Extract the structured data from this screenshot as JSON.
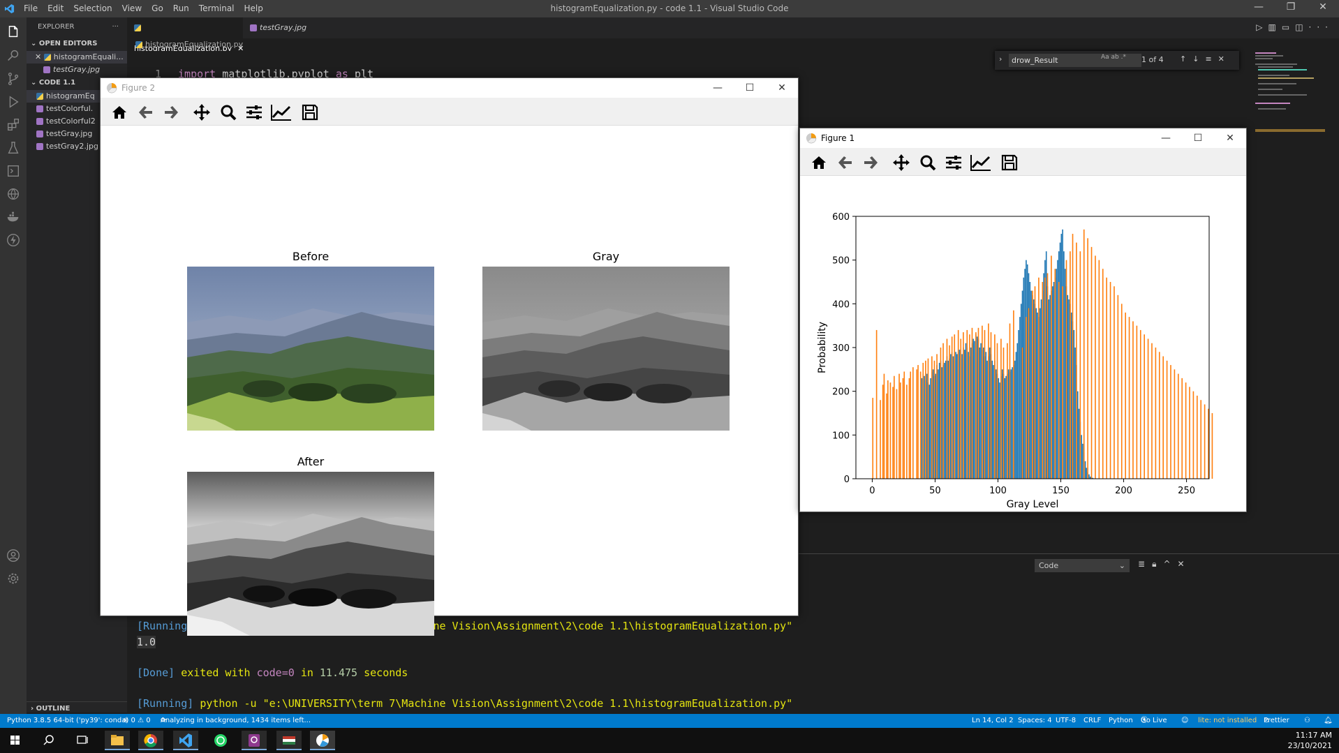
{
  "window": {
    "title": "histogramEqualization.py - code 1.1 - Visual Studio Code",
    "menu": [
      "File",
      "Edit",
      "Selection",
      "View",
      "Go",
      "Run",
      "Terminal",
      "Help"
    ]
  },
  "sidebar": {
    "header": "EXPLORER",
    "open_editors_label": "OPEN EDITORS",
    "open_editors": [
      "histogramEquali...",
      "testGray.jpg"
    ],
    "folder_label": "CODE 1.1",
    "files": [
      "histogramEq",
      "testColorful.",
      "testColorful2",
      "testGray.jpg",
      "testGray2.jpg"
    ],
    "outline_label": "OUTLINE"
  },
  "tabs": [
    {
      "label": "histogramEqualization.py",
      "active": true
    },
    {
      "label": "testGray.jpg",
      "active": false
    }
  ],
  "breadcrumb": "histogramEqualization.py",
  "editor": {
    "line_number": "1",
    "code": {
      "kw1": "import",
      "mod": "matplotlib.pyplot",
      "kw2": "as",
      "alias": "plt"
    }
  },
  "find": {
    "query": "drow_Result",
    "options": "Aa ab .*",
    "count": "1 of 4"
  },
  "panel": {
    "select_value": "Code",
    "lines": [
      {
        "tag": "[Running]",
        "text": "python -u \"e:\\UNIVERSITY\\term 7\\Machine Vision\\Assignment\\2\\code 1.1\\histogramEqualization.py\""
      },
      {
        "value": "1.0"
      },
      {
        "tag": "[Done]",
        "text1": "exited with",
        "code": "code=0",
        "text2": "in",
        "secs": "11.475",
        "text3": "seconds"
      },
      {
        "tag": "[Running]",
        "text": "python -u \"e:\\UNIVERSITY\\term 7\\Machine Vision\\Assignment\\2\\code 1.1\\histogramEqualization.py\""
      }
    ]
  },
  "statusbar": {
    "python": "Python 3.8.5 64-bit ('py39': conda)",
    "problems": "⊗ 0 ⚠ 0",
    "analysis": "Analyzing in background, 1434 items left...",
    "position": "Ln 14, Col 2",
    "spaces": "Spaces: 4",
    "encoding": "UTF-8",
    "eol": "CRLF",
    "language": "Python",
    "golive": "Go Live",
    "lite": "lite: not installed",
    "prettier": "Prettier"
  },
  "taskbar": {
    "time": "11:17 AM",
    "date": "23/10/2021"
  },
  "figure2": {
    "title": "Figure 2",
    "subplots": [
      "Before",
      "Gray",
      "After"
    ]
  },
  "figure1": {
    "title": "Figure 1"
  },
  "chart_data": {
    "type": "bar",
    "title": "",
    "xlabel": "Gray Level",
    "ylabel": "Probability",
    "xlim": [
      -13,
      268
    ],
    "ylim": [
      0,
      600
    ],
    "xticks": [
      0,
      50,
      100,
      150,
      200,
      250
    ],
    "yticks": [
      0,
      100,
      200,
      300,
      400,
      500,
      600
    ],
    "series": [
      {
        "color": "#1f77b4",
        "x_start": 0,
        "values": [
          0,
          0,
          0,
          0,
          0,
          0,
          0,
          0,
          0,
          0,
          0,
          0,
          0,
          0,
          0,
          0,
          0,
          0,
          0,
          0,
          0,
          0,
          0,
          0,
          0,
          0,
          0,
          0,
          0,
          0,
          0,
          0,
          0,
          0,
          0,
          0,
          0,
          0,
          0,
          230,
          240,
          235,
          225,
          240,
          220,
          215,
          230,
          245,
          250,
          235,
          240,
          260,
          250,
          265,
          270,
          255,
          260,
          265,
          270,
          280,
          270,
          275,
          285,
          290,
          280,
          270,
          290,
          285,
          290,
          295,
          275,
          285,
          300,
          295,
          310,
          300,
          290,
          280,
          300,
          310,
          320,
          315,
          330,
          325,
          320,
          300,
          310,
          295,
          300,
          280,
          290,
          270,
          280,
          300,
          285,
          270,
          260,
          270,
          250,
          240,
          230,
          220,
          235,
          250,
          240,
          230,
          235,
          240,
          250,
          245,
          250,
          255,
          260,
          270,
          290,
          310,
          340,
          370,
          400,
          430,
          460,
          480,
          500,
          490,
          470,
          450,
          430,
          420,
          410,
          400,
          390,
          380,
          370,
          390,
          410,
          430,
          470,
          500,
          520,
          440,
          410,
          420,
          430,
          440,
          450,
          460,
          480,
          500,
          520,
          540,
          560,
          570,
          520,
          480,
          440,
          420,
          410,
          400,
          380,
          360,
          340,
          300,
          260,
          200,
          160,
          130,
          100,
          80,
          60,
          40,
          25,
          15,
          10,
          5,
          3,
          2,
          0,
          0,
          0,
          0,
          0,
          0,
          0,
          0,
          0,
          0,
          0,
          0,
          0,
          0,
          0,
          0,
          0,
          0,
          0,
          0,
          0,
          0,
          0,
          0,
          0,
          0,
          0,
          0,
          0,
          0,
          0,
          0,
          0,
          0,
          0,
          0,
          0,
          0,
          0,
          0,
          0,
          0,
          0,
          0,
          0,
          0,
          0,
          0,
          0,
          0,
          0,
          0,
          0,
          0,
          0,
          0,
          0,
          0,
          0,
          0
        ]
      },
      {
        "color": "#ff7f0e",
        "x_start": 0,
        "values": [
          185,
          0,
          0,
          340,
          0,
          0,
          180,
          0,
          215,
          240,
          0,
          195,
          225,
          0,
          220,
          0,
          210,
          235,
          0,
          205,
          0,
          240,
          220,
          0,
          230,
          245,
          0,
          215,
          0,
          230,
          245,
          0,
          255,
          0,
          0,
          250,
          260,
          0,
          245,
          0,
          265,
          0,
          270,
          0,
          275,
          0,
          0,
          280,
          0,
          270,
          0,
          285,
          0,
          0,
          300,
          0,
          310,
          0,
          0,
          320,
          0,
          305,
          0,
          325,
          0,
          330,
          0,
          0,
          340,
          0,
          320,
          0,
          335,
          0,
          0,
          340,
          0,
          330,
          0,
          345,
          0,
          0,
          335,
          0,
          345,
          0,
          0,
          350,
          0,
          340,
          0,
          0,
          355,
          0,
          335,
          0,
          0,
          330,
          0,
          310,
          0,
          0,
          320,
          0,
          300,
          0,
          0,
          310,
          0,
          355,
          0,
          0,
          385,
          0,
          0,
          0,
          0,
          0,
          0,
          300,
          0,
          0,
          370,
          0,
          390,
          0,
          0,
          430,
          0,
          440,
          0,
          0,
          460,
          0,
          0,
          450,
          0,
          460,
          0,
          470,
          0,
          0,
          510,
          0,
          0,
          480,
          0,
          0,
          450,
          0,
          0,
          440,
          0,
          0,
          500,
          0,
          0,
          520,
          0,
          560,
          0,
          0,
          540,
          0,
          0,
          520,
          0,
          0,
          570,
          0,
          0,
          550,
          0,
          0,
          530,
          0,
          0,
          510,
          0,
          0,
          500,
          0,
          0,
          480,
          0,
          0,
          460,
          0,
          0,
          450,
          0,
          0,
          440,
          0,
          0,
          420,
          0,
          0,
          400,
          0,
          0,
          380,
          0,
          0,
          370,
          0,
          0,
          360,
          0,
          0,
          350,
          0,
          0,
          340,
          0,
          0,
          330,
          0,
          0,
          320,
          0,
          0,
          310,
          0,
          0,
          300,
          0,
          0,
          290,
          0,
          0,
          280,
          0,
          0,
          270,
          0,
          0,
          260,
          0,
          0,
          250,
          0,
          0,
          240,
          0,
          0,
          230,
          0,
          0,
          220,
          0,
          0,
          210,
          0,
          0,
          200,
          0,
          0,
          190,
          0,
          0,
          180,
          0,
          0,
          170,
          0,
          0,
          160,
          0,
          0,
          150
        ]
      }
    ]
  }
}
